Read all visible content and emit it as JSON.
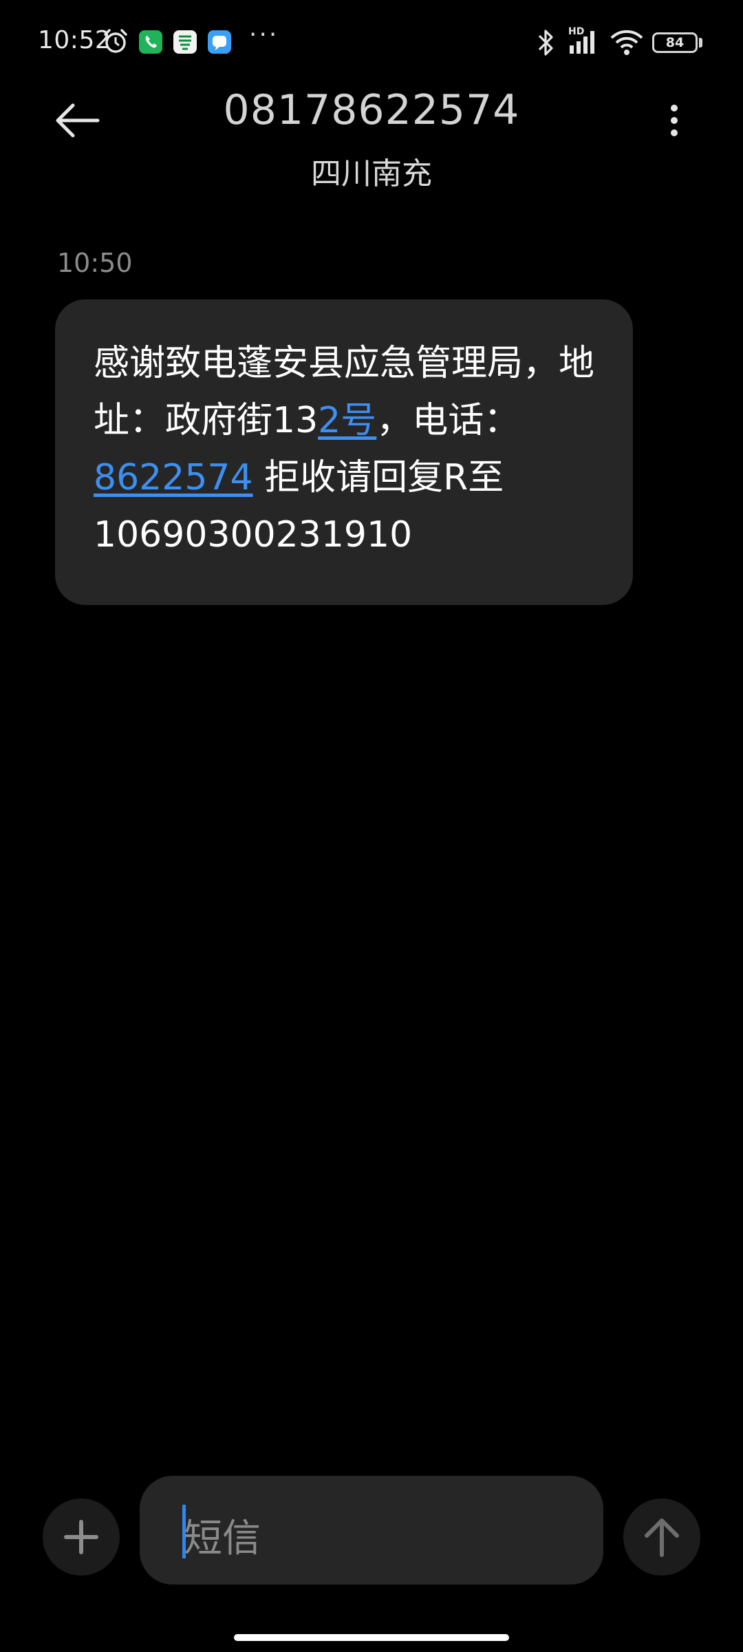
{
  "status_bar": {
    "time": "10:52",
    "more": "···",
    "hd": "HD",
    "battery": "84",
    "battery_fraction": 0.84
  },
  "header": {
    "phone_number": "08178622574",
    "location": "四川南充"
  },
  "conversation": {
    "timestamp": "10:50",
    "message": {
      "part1": "感谢致电蓬安县应急管理局，地址：政府街13",
      "link1": "2号",
      "part2": "，电话：",
      "link2": "8622574",
      "part3": " 拒收请回复R至10690300231910"
    }
  },
  "composer": {
    "placeholder": "短信"
  },
  "colors": {
    "background": "#000000",
    "bubble": "#262626",
    "link": "#3d8ff2",
    "caret": "#2f86f0"
  },
  "icons": [
    "alarm-icon",
    "phone-app-icon",
    "post-app-icon",
    "message-app-icon",
    "bluetooth-icon",
    "signal-icon",
    "wifi-icon",
    "battery-icon",
    "back-arrow-icon",
    "more-vert-icon",
    "plus-icon",
    "send-arrow-icon"
  ]
}
